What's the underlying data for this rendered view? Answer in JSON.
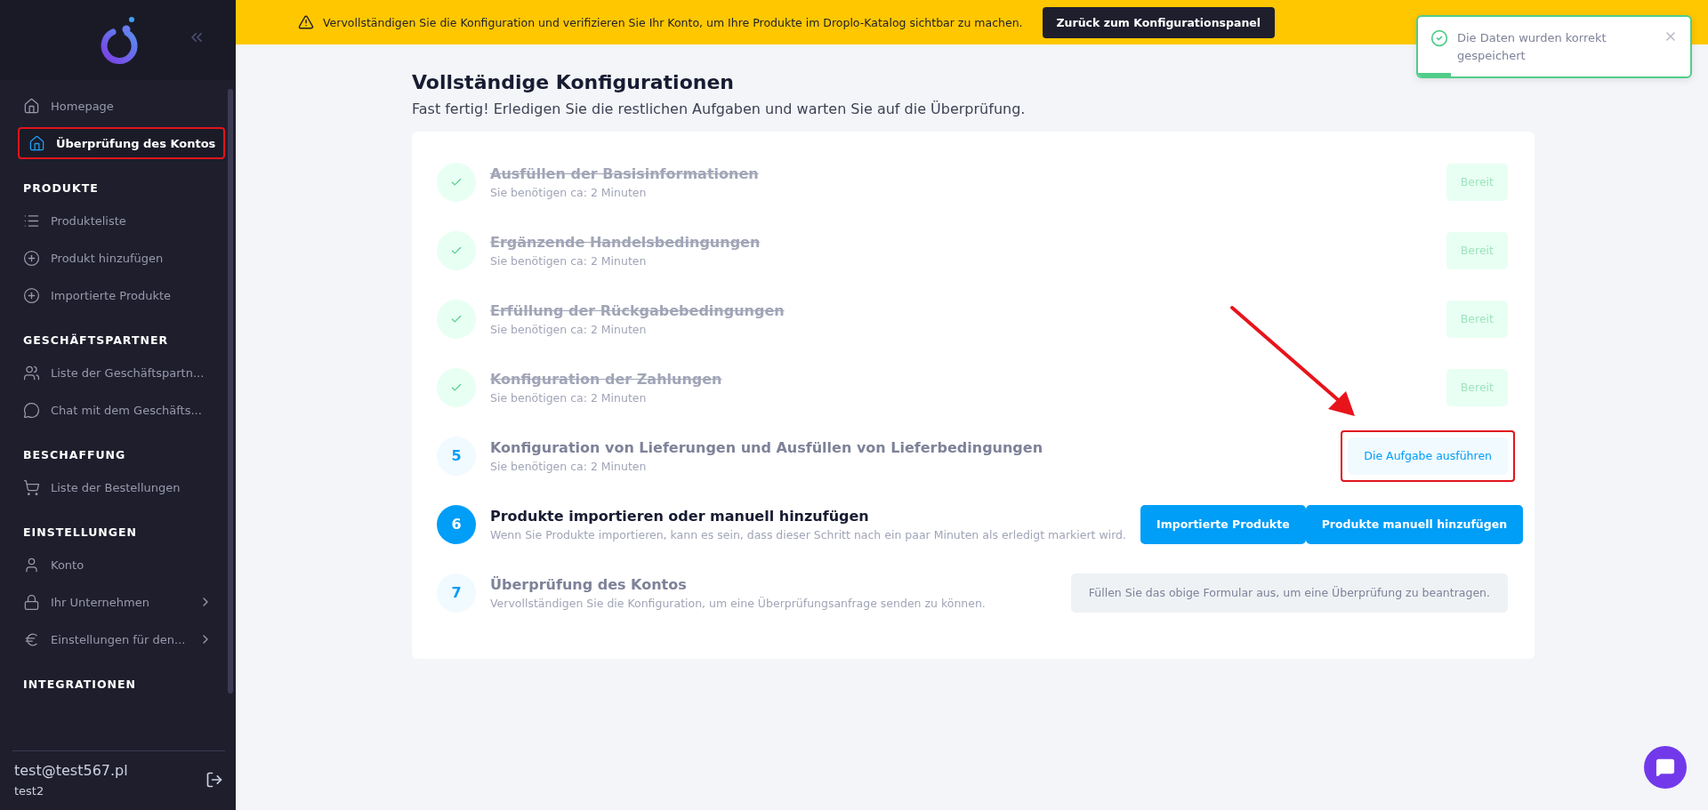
{
  "sidebar": {
    "top_items": [
      {
        "label": "Homepage",
        "kind": "home",
        "selected": false,
        "highlighted": false
      },
      {
        "label": "Überprüfung des Kontos",
        "kind": "home",
        "selected": true,
        "highlighted": true
      }
    ],
    "sections": [
      {
        "title": "PRODUKTE",
        "items": [
          {
            "label": "Produkteliste",
            "kind": "list",
            "submenu": false
          },
          {
            "label": "Produkt hinzufügen",
            "kind": "plus",
            "submenu": false
          },
          {
            "label": "Importierte Produkte",
            "kind": "plus",
            "submenu": false
          }
        ]
      },
      {
        "title": "GESCHÄFTSPARTNER",
        "items": [
          {
            "label": "Liste der Geschäftspartn...",
            "kind": "users",
            "submenu": false
          },
          {
            "label": "Chat mit dem Geschäfts...",
            "kind": "chat",
            "submenu": false
          }
        ]
      },
      {
        "title": "BESCHAFFUNG",
        "items": [
          {
            "label": "Liste der Bestellungen",
            "kind": "cart",
            "submenu": false
          }
        ]
      },
      {
        "title": "EINSTELLUNGEN",
        "items": [
          {
            "label": "Konto",
            "kind": "user",
            "submenu": false
          },
          {
            "label": "Ihr Unternehmen",
            "kind": "lock",
            "submenu": true
          },
          {
            "label": "Einstellungen für den...",
            "kind": "euro",
            "submenu": true
          }
        ]
      },
      {
        "title": "INTEGRATIONEN"
      }
    ],
    "user": {
      "email": "test@test567.pl",
      "name": "test2"
    }
  },
  "banner": {
    "text": "Vervollständigen Sie die Konfiguration und verifizieren Sie Ihr Konto, um Ihre Produkte im Droplo-Katalog sichtbar zu machen.",
    "button": "Zurück zum Konfigurationspanel"
  },
  "toast": {
    "message": "Die Daten wurden korrekt gespeichert",
    "level": 0.12
  },
  "page": {
    "title": "Vollständige Konfigurationen",
    "subtitle": "Fast fertig! Erledigen Sie die restlichen Aufgaben und warten Sie auf die Überprüfung."
  },
  "tasks": [
    {
      "kind": "done",
      "title": "Ausfüllen der Basisinformationen",
      "hint": "Sie benötigen ca: 2 Minuten",
      "actions": [
        {
          "label": "Bereit",
          "kind": "ready"
        }
      ]
    },
    {
      "kind": "done",
      "title": "Ergänzende Handelsbedingungen",
      "hint": "Sie benötigen ca: 2 Minuten",
      "actions": [
        {
          "label": "Bereit",
          "kind": "ready"
        }
      ]
    },
    {
      "kind": "done",
      "title": "Erfüllung der Rückgabebedingungen",
      "hint": "Sie benötigen ca: 2 Minuten",
      "actions": [
        {
          "label": "Bereit",
          "kind": "ready"
        }
      ]
    },
    {
      "kind": "done",
      "title": "Konfiguration der Zahlungen",
      "hint": "Sie benötigen ca: 2 Minuten",
      "actions": [
        {
          "label": "Bereit",
          "kind": "ready"
        }
      ]
    },
    {
      "kind": "pending",
      "step": "5",
      "title": "Konfiguration von Lieferungen und Ausfüllen von Lieferbedingungen",
      "hint": "Sie benötigen ca: 2 Minuten",
      "actions": [
        {
          "label": "Die Aufgabe ausführen",
          "kind": "light",
          "highlighted": true
        }
      ]
    },
    {
      "kind": "active",
      "step": "6",
      "title": "Produkte importieren oder manuell hinzufügen",
      "hint": "Wenn Sie Produkte importieren, kann es sein, dass dieser Schritt nach ein paar Minuten als erledigt markiert wird.",
      "actions": [
        {
          "label": "Importierte Produkte",
          "kind": "primary"
        },
        {
          "label": "Produkte manuell hinzufügen",
          "kind": "primary"
        }
      ]
    },
    {
      "kind": "pending",
      "step": "7",
      "title": "Überprüfung des Kontos",
      "hint": "Vervollständigen Sie die Konfiguration, um eine Überprüfungsanfrage senden zu können.",
      "actions": [
        {
          "label": "Füllen Sie das obige Formular aus, um eine Überprüfung zu beantragen.",
          "kind": "disabled"
        }
      ]
    }
  ]
}
